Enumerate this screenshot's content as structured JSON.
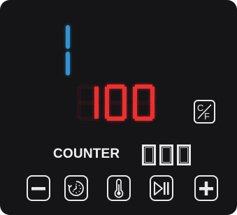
{
  "display": {
    "program_number": "1",
    "temperature": "100",
    "counter_label": "COUNTER",
    "counter_value": "000",
    "colors": {
      "program": "#2f95d6",
      "temperature": "#f22d2d",
      "counter": "#e6e6e6",
      "background": "#151517"
    }
  },
  "buttons": [
    {
      "id": "unit",
      "icon": "celsius-fahrenheit-icon"
    },
    {
      "id": "minus",
      "icon": "minus-icon"
    },
    {
      "id": "timer",
      "icon": "timer-dial-icon"
    },
    {
      "id": "temperature",
      "icon": "thermometer-icon"
    },
    {
      "id": "play_pause",
      "icon": "play-pause-icon"
    },
    {
      "id": "plus",
      "icon": "plus-icon"
    }
  ],
  "unit_toggle": {
    "upper": "C",
    "lower": "F"
  }
}
